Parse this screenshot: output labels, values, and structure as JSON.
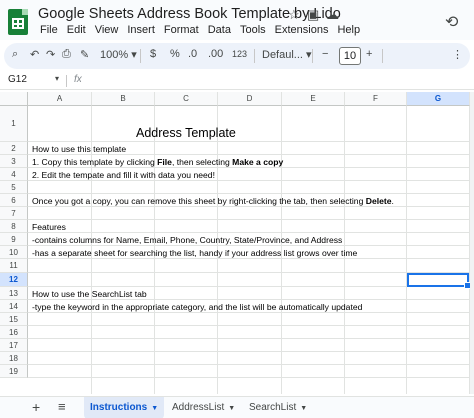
{
  "doc": {
    "title": "Google Sheets Address Book Template by Lido",
    "star_icon": "star-icon",
    "move_icon": "folder-move-icon",
    "cloud_icon": "cloud-status-icon",
    "history_icon": "history-icon"
  },
  "menu": [
    "File",
    "Edit",
    "View",
    "Insert",
    "Format",
    "Data",
    "Tools",
    "Extensions",
    "Help"
  ],
  "toolbar": {
    "zoom": "100%",
    "currency": "$",
    "percent": "%",
    "decrease_decimal": ".0",
    "increase_decimal": ".00",
    "number_format": "123",
    "font": "Defaul...",
    "font_size": "10",
    "minus": "−",
    "plus": "+"
  },
  "formula_bar": {
    "cell_ref": "G12",
    "fx": "fx",
    "value": ""
  },
  "columns": [
    "A",
    "B",
    "C",
    "D",
    "E",
    "F",
    "G"
  ],
  "selected_column": "G",
  "rows": [
    "1",
    "2",
    "3",
    "4",
    "5",
    "6",
    "7",
    "8",
    "9",
    "10",
    "11",
    "12",
    "13",
    "14",
    "15",
    "16",
    "17",
    "18",
    "19"
  ],
  "selected_row": "12",
  "cells": {
    "a1_title": "Address Template",
    "a2": "How to use this template",
    "a3_pre": "1. Copy this template by clicking ",
    "a3_b1": "File",
    "a3_mid": ", then selecting ",
    "a3_b2": "Make a copy",
    "a4": "2. Edit the tempate and fill it with data you need!",
    "a6_pre": "Once you got a copy, you can remove this sheet by right-clicking the tab, then selecting ",
    "a6_b": "Delete",
    "a6_post": ".",
    "a8": "Features",
    "a9": "-contains columns for Name, Email, Phone, Country, State/Province, and Address",
    "a10": "-has a separate sheet for searching the list, handy if your address list grows over time",
    "a13": "How to use the SearchList tab",
    "a14": "-type the keyword in the appropriate category, and the list will be automatically updated"
  },
  "sheets": {
    "add": "+",
    "all": "≡",
    "tabs": [
      "Instructions",
      "AddressList",
      "SearchList"
    ],
    "active": "Instructions"
  }
}
